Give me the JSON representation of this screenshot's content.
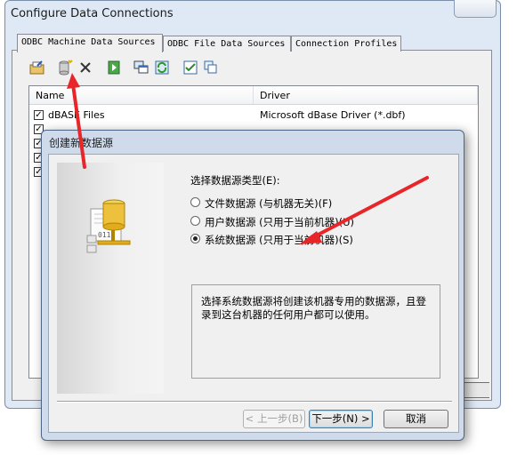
{
  "background_window": {
    "title": "Configure Data Connections",
    "tabs": [
      {
        "label": "ODBC Machine Data Sources",
        "active": true
      },
      {
        "label": "ODBC File Data Sources",
        "active": false
      },
      {
        "label": "Connection Profiles",
        "active": false
      }
    ],
    "toolbar_icons": [
      "configure-icon",
      "new-datasource-icon",
      "delete-icon",
      "run-icon",
      "properties-icon",
      "refresh-icon",
      "check-all-icon",
      "copy-icon"
    ],
    "columns": [
      "Name",
      "Driver"
    ],
    "rows": [
      {
        "name": "dBASE Files",
        "driver": "Microsoft dBase Driver (*.dbf)",
        "checked": true
      }
    ]
  },
  "dialog": {
    "title": "创建新数据源",
    "prompt": "选择数据源类型(E):",
    "options": [
      {
        "label": "文件数据源 (与机器无关)(F)",
        "selected": false
      },
      {
        "label": "用户数据源 (只用于当前机器)(U)",
        "selected": false
      },
      {
        "label": "系统数据源 (只用于当前机器)(S)",
        "selected": true
      }
    ],
    "description": "选择系统数据源将创建该机器专用的数据源，且登录到这台机器的任何用户都可以使用。",
    "buttons": {
      "back": "< 上一步(B)",
      "next": "下一步(N) >",
      "cancel": "取消"
    },
    "icon": "database-server-icon"
  },
  "annotation_color": "#e8262a"
}
